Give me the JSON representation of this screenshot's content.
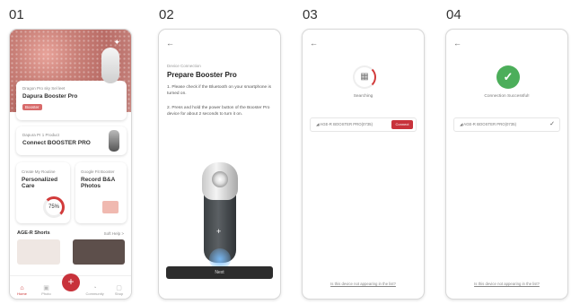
{
  "steps": [
    {
      "number": "01"
    },
    {
      "number": "02"
    },
    {
      "number": "03"
    },
    {
      "number": "04"
    }
  ],
  "screen1": {
    "hero_card_small": "Dragon Pro sky Sel leet",
    "hero_card_title": "Dapura Booster Pro",
    "hero_card_badge": "Booster",
    "connect_small": "Dapura Pr 1 Product",
    "connect_title": "Connect BOOSTER PRO",
    "care_small": "Create My Routine",
    "care_title": "Personalized Care",
    "care_value": "75",
    "care_unit": "%",
    "photo_small": "Google Fit Booster",
    "photo_title": "Record B&A Photos",
    "section_title": "AGE-R Shorts",
    "section_more": "Soft Help >",
    "nav": [
      "Home",
      "Photo",
      "",
      "Community",
      "Shop"
    ]
  },
  "screen2": {
    "eyebrow": "Device Connection",
    "title": "Prepare Booster Pro",
    "step1": "1. Please check if the Bluetooth on your smartphone is turned on.",
    "step2": "2. Press and hold the power button of the Booster Pro device for about 2 seconds to turn it on.",
    "button": "Next"
  },
  "screen3": {
    "status": "Searching",
    "device": "AGE-R BOOSTER PRO(0735)",
    "connect": "Connect",
    "footer": "Is this device not appearing in the list?"
  },
  "screen4": {
    "status": "Connection Successful!",
    "device": "AGE-R BOOSTER PRO(0735)",
    "footer": "Is this device not appearing in the list?"
  },
  "colors": {
    "accent_red": "#c8323b",
    "success_green": "#4cae5a"
  },
  "icons": [
    "back-arrow-icon",
    "search-icon",
    "check-icon",
    "plus-icon",
    "home-icon",
    "photo-icon",
    "community-icon",
    "shop-icon"
  ]
}
